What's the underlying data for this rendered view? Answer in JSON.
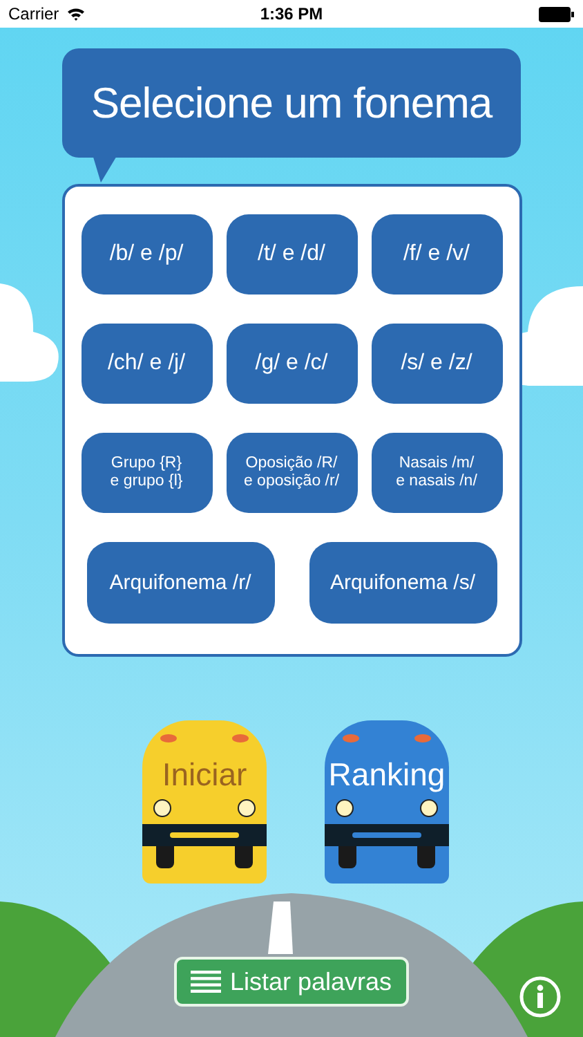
{
  "status_bar": {
    "carrier": "Carrier",
    "time": "1:36 PM"
  },
  "title": "Selecione um fonema",
  "phonemes": [
    {
      "label": "/b/ e /p/",
      "kind": "small"
    },
    {
      "label": "/t/ e /d/",
      "kind": "small"
    },
    {
      "label": "/f/ e /v/",
      "kind": "small"
    },
    {
      "label": "/ch/ e /j/",
      "kind": "small"
    },
    {
      "label": "/g/ e /c/",
      "kind": "small"
    },
    {
      "label": "/s/ e /z/",
      "kind": "small"
    },
    {
      "label": "Grupo {R}\ne grupo {l}",
      "kind": "small"
    },
    {
      "label": "Oposição /R/\ne oposição /r/",
      "kind": "small"
    },
    {
      "label": "Nasais /m/\ne nasais /n/",
      "kind": "small"
    },
    {
      "label": "Arquifonema /r/",
      "kind": "wide"
    },
    {
      "label": "Arquifonema /s/",
      "kind": "wide"
    }
  ],
  "buses": [
    {
      "label": "Iniciar",
      "kind": "yellow"
    },
    {
      "label": "Ranking",
      "kind": "blue"
    }
  ],
  "list_button": {
    "label": "Listar palavras"
  }
}
